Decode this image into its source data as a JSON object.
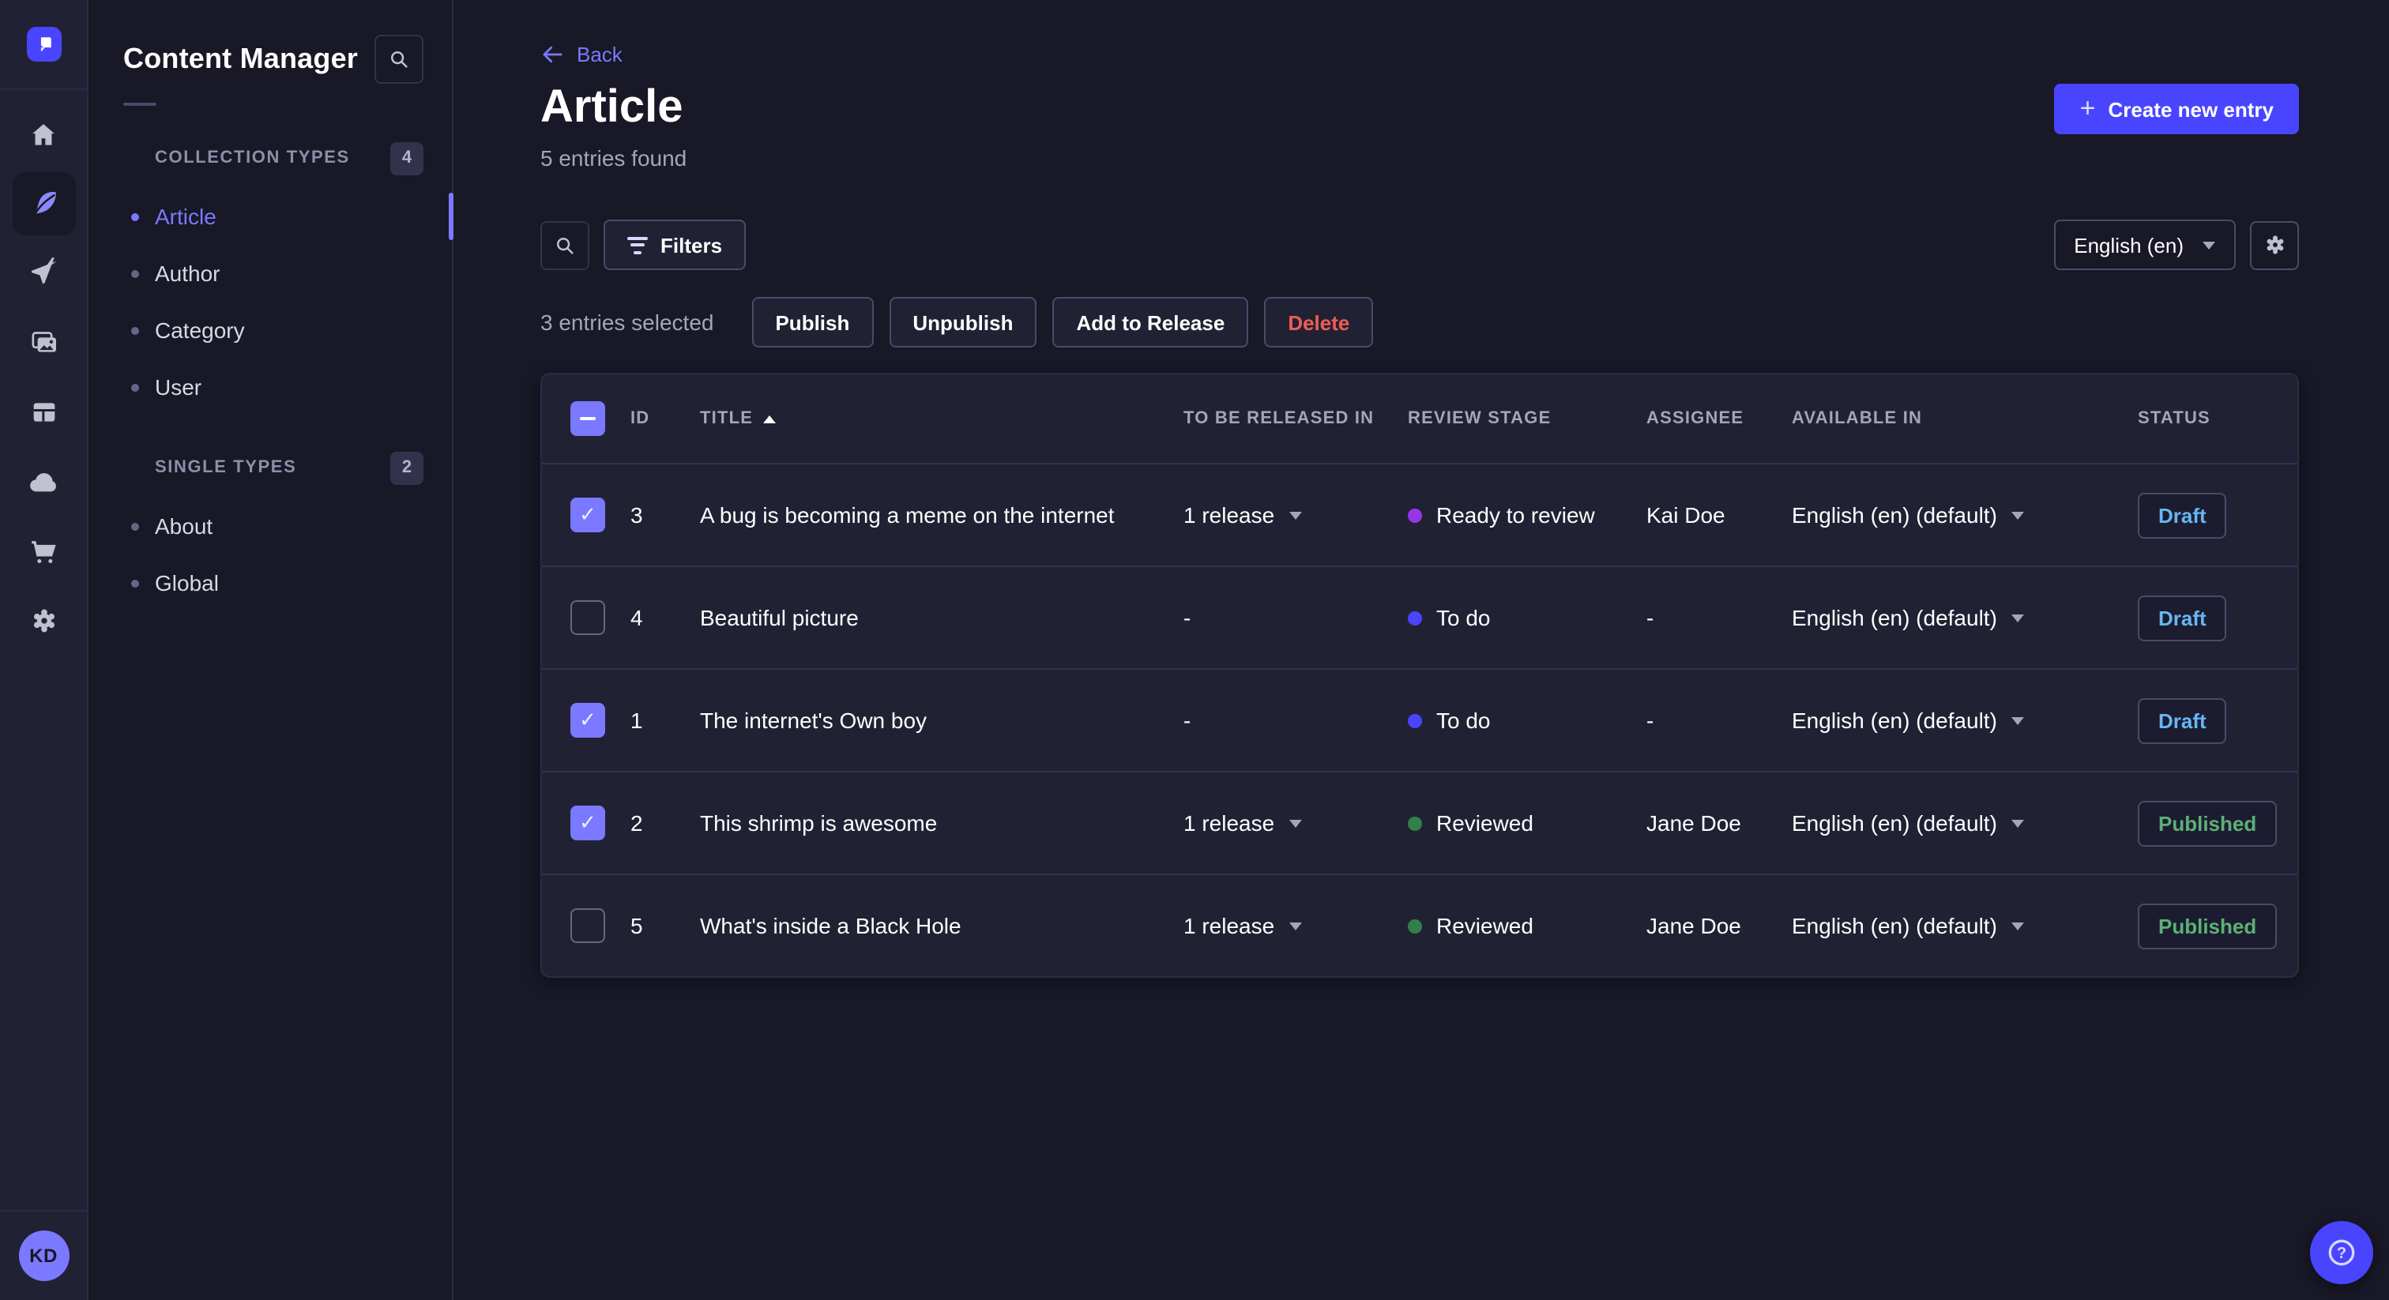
{
  "colors": {
    "primary": "#4945ff",
    "primary_light": "#7b79ff",
    "danger": "#ee5e52",
    "draft": "#66b7f1",
    "published": "#5cb176",
    "stage_todo": "#4945ff",
    "stage_ready": "#9736e8",
    "stage_reviewed": "#328048"
  },
  "rail": {
    "avatar_initials": "KD",
    "items": [
      "home",
      "content-manager",
      "releases",
      "media-library",
      "content-type-builder",
      "deploy",
      "marketplace",
      "settings"
    ],
    "active_item": "content-manager"
  },
  "nav": {
    "title": "Content Manager"
  },
  "sidebar": {
    "collection_types": {
      "label": "COLLECTION TYPES",
      "count": "4",
      "items": [
        {
          "label": "Article",
          "active": true
        },
        {
          "label": "Author",
          "active": false
        },
        {
          "label": "Category",
          "active": false
        },
        {
          "label": "User",
          "active": false
        }
      ]
    },
    "single_types": {
      "label": "SINGLE TYPES",
      "count": "2",
      "items": [
        {
          "label": "About",
          "active": false
        },
        {
          "label": "Global",
          "active": false
        }
      ]
    }
  },
  "header": {
    "back": "Back",
    "title": "Article",
    "subtitle": "5 entries found",
    "create": "Create new entry"
  },
  "toolbar": {
    "filters": "Filters",
    "locale": "English (en)"
  },
  "selection": {
    "label": "3 entries selected",
    "publish": "Publish",
    "unpublish": "Unpublish",
    "add_to_release": "Add to Release",
    "delete_label": "Delete"
  },
  "table": {
    "header": {
      "id": "ID",
      "title": "TITLE",
      "released": "TO BE RELEASED IN",
      "review": "REVIEW STAGE",
      "assignee": "ASSIGNEE",
      "available": "AVAILABLE IN",
      "status": "STATUS"
    },
    "rows": [
      {
        "checked": true,
        "id": "3",
        "title": "A bug is becoming a meme on the internet",
        "released": "1 release",
        "released_caret": true,
        "review": {
          "label": "Ready to review",
          "color": "#9736e8"
        },
        "assignee": "Kai Doe",
        "available": "English (en) (default)",
        "status": {
          "label": "Draft",
          "color": "#66b7f1"
        }
      },
      {
        "checked": false,
        "id": "4",
        "title": "Beautiful picture",
        "released": "-",
        "released_caret": false,
        "review": {
          "label": "To do",
          "color": "#4945ff"
        },
        "assignee": "-",
        "available": "English (en) (default)",
        "status": {
          "label": "Draft",
          "color": "#66b7f1"
        }
      },
      {
        "checked": true,
        "id": "1",
        "title": "The internet's Own boy",
        "released": "-",
        "released_caret": false,
        "review": {
          "label": "To do",
          "color": "#4945ff"
        },
        "assignee": "-",
        "available": "English (en) (default)",
        "status": {
          "label": "Draft",
          "color": "#66b7f1"
        }
      },
      {
        "checked": true,
        "id": "2",
        "title": "This shrimp is awesome",
        "released": "1 release",
        "released_caret": true,
        "review": {
          "label": "Reviewed",
          "color": "#328048"
        },
        "assignee": "Jane Doe",
        "available": "English (en) (default)",
        "status": {
          "label": "Published",
          "color": "#5cb176"
        }
      },
      {
        "checked": false,
        "id": "5",
        "title": "What's inside a Black Hole",
        "released": "1 release",
        "released_caret": true,
        "review": {
          "label": "Reviewed",
          "color": "#328048"
        },
        "assignee": "Jane Doe",
        "available": "English (en) (default)",
        "status": {
          "label": "Published",
          "color": "#5cb176"
        }
      }
    ]
  }
}
